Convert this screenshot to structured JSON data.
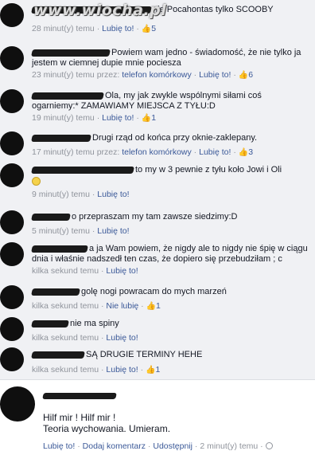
{
  "watermark": "www.wiocha.pl",
  "comments": [
    {
      "text": "nie Pocahontas tylko SCOOBY",
      "time": "28 minut(y) temu",
      "via": "",
      "like": "Lubię to!",
      "likes": "5"
    },
    {
      "text": "Powiem wam jedno - świadomość, że nie tylko ja jestem w ciemnej dupie mnie pociesza",
      "time": "23 minut(y) temu przez:",
      "via": "telefon komórkowy",
      "like": "Lubię to!",
      "likes": "6"
    },
    {
      "text": "Ola, my jak zwykle wspólnymi siłami coś ogarniemy:* ZAMAWIAMY MIEJSCA Z TYŁU:D",
      "time": "19 minut(y) temu",
      "via": "",
      "like": "Lubię to!",
      "likes": "1"
    },
    {
      "text": "Drugi rząd od końca przy oknie-zaklepany.",
      "time": "17 minut(y) temu przez:",
      "via": "telefon komórkowy",
      "like": "Lubię to!",
      "likes": "3"
    },
    {
      "text": "to my w 3 pewnie z tyłu koło Jowi i Oli",
      "time": "9 minut(y) temu",
      "via": "",
      "like": "Lubię to!",
      "likes": ""
    },
    {
      "text": "o przepraszam my tam zawsze siedzimy:D",
      "time": "5 minut(y) temu",
      "via": "",
      "like": "Lubię to!",
      "likes": ""
    },
    {
      "text": "a ja Wam powiem, że nigdy ale to nigdy nie śpię w ciągu dnia i właśnie nadszedł ten czas, że dopiero się przebudziłam ; c",
      "time": "kilka sekund temu",
      "via": "",
      "like": "Lubię to!",
      "likes": ""
    },
    {
      "text": "golę nogi powracam do mych marzeń",
      "time": "kilka sekund temu",
      "via": "",
      "like": "Nie lubię",
      "likes": "1"
    },
    {
      "text": "nie ma spiny",
      "time": "kilka sekund temu",
      "via": "",
      "like": "Lubię to!",
      "likes": ""
    },
    {
      "text": "SĄ DRUGIE TERMINY HEHE",
      "time": "kilka sekund temu",
      "via": "",
      "like": "Lubię to!",
      "likes": "1"
    }
  ],
  "post": {
    "line1": "Hilf mir ! Hilf mir !",
    "line2": "Teoria wychowania. Umieram.",
    "like": "Lubię to!",
    "comment": "Dodaj komentarz",
    "share": "Udostępnij",
    "time": "2 minut(y) temu"
  }
}
